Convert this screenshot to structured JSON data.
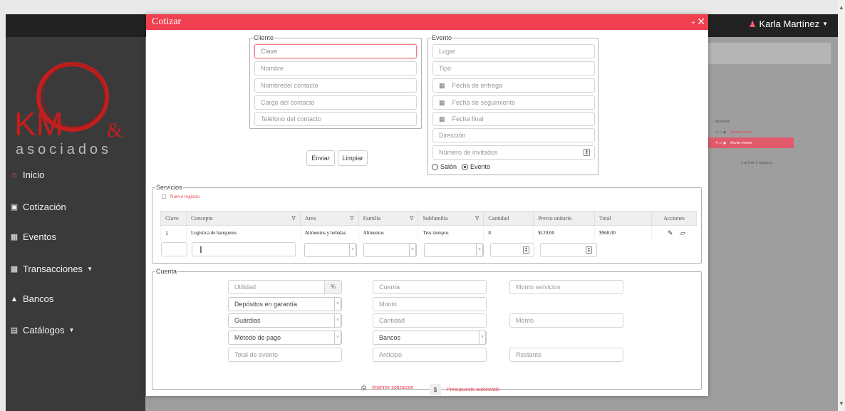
{
  "header": {
    "user_name": "Karla Martínez"
  },
  "logo": {
    "brand": "KM",
    "amp": "&",
    "sub": "asociados"
  },
  "sidebar": {
    "items": [
      {
        "label": "Inicio"
      },
      {
        "label": "Cotización"
      },
      {
        "label": "Eventos"
      },
      {
        "label": "Transacciones"
      },
      {
        "label": "Bancos"
      },
      {
        "label": "Catálogos"
      }
    ]
  },
  "background_table": {
    "header": "Acciones",
    "action": "Enviar evento",
    "footer": "1 al 2 de 2 registros"
  },
  "modal": {
    "title": "Cotizar",
    "min": "+",
    "close": "✕"
  },
  "cliente": {
    "legend": "Cliente",
    "clave": "Clave",
    "nombre": "Nombre",
    "contacto": "Nombredel contacto",
    "cargo": "Cargo del contacto",
    "telefono": "Teléfono del contacto",
    "enviar": "Enviar",
    "limpiar": "Limpiar"
  },
  "evento": {
    "legend": "Evento",
    "lugar": "Lugar",
    "tipo": "Tipo",
    "fecha_entrega": "Fecha de entrega",
    "fecha_seguimiento": "Fecha de seguimiento",
    "fecha_final": "Fecha final",
    "direccion": "Dirección",
    "invitados": "Número de invitados",
    "radio_salon": "Salón",
    "radio_evento": "Evento"
  },
  "servicios": {
    "legend": "Servicios",
    "new_record": "Nuevo registro",
    "columns": [
      "Clave",
      "Concepto",
      "Area",
      "Familia",
      "Subfamilia",
      "Cantidad",
      "Precio unitario",
      "Total",
      "Acciones"
    ],
    "row": {
      "clave": "1",
      "concepto": "Logística de banquetes",
      "area": "Alimentos y bebidas",
      "familia": "Alimentos",
      "subfamilia": "Tres tiempos",
      "cantidad": "8",
      "precio": "$120.00",
      "total": "$960.00"
    }
  },
  "cuenta": {
    "legend": "Cuenta",
    "utilidad": "Utilidad",
    "percent": "%",
    "cuenta": "Cuenta",
    "monto_servicios": "Monto servicios",
    "depositos": "Depósitos en garantía",
    "monto": "Monto",
    "guardias": "Guardias",
    "cantidad": "Cantidad",
    "monto2": "Monto",
    "metodo": "Método de pago",
    "bancos": "Bancos",
    "total_evento": "Total de evento",
    "anticipo": "Anticipo",
    "restante": "Restante",
    "imprimir": "Imprimir cotización",
    "dollar": "$",
    "presupuesto": "Presupuesto autorizado"
  }
}
